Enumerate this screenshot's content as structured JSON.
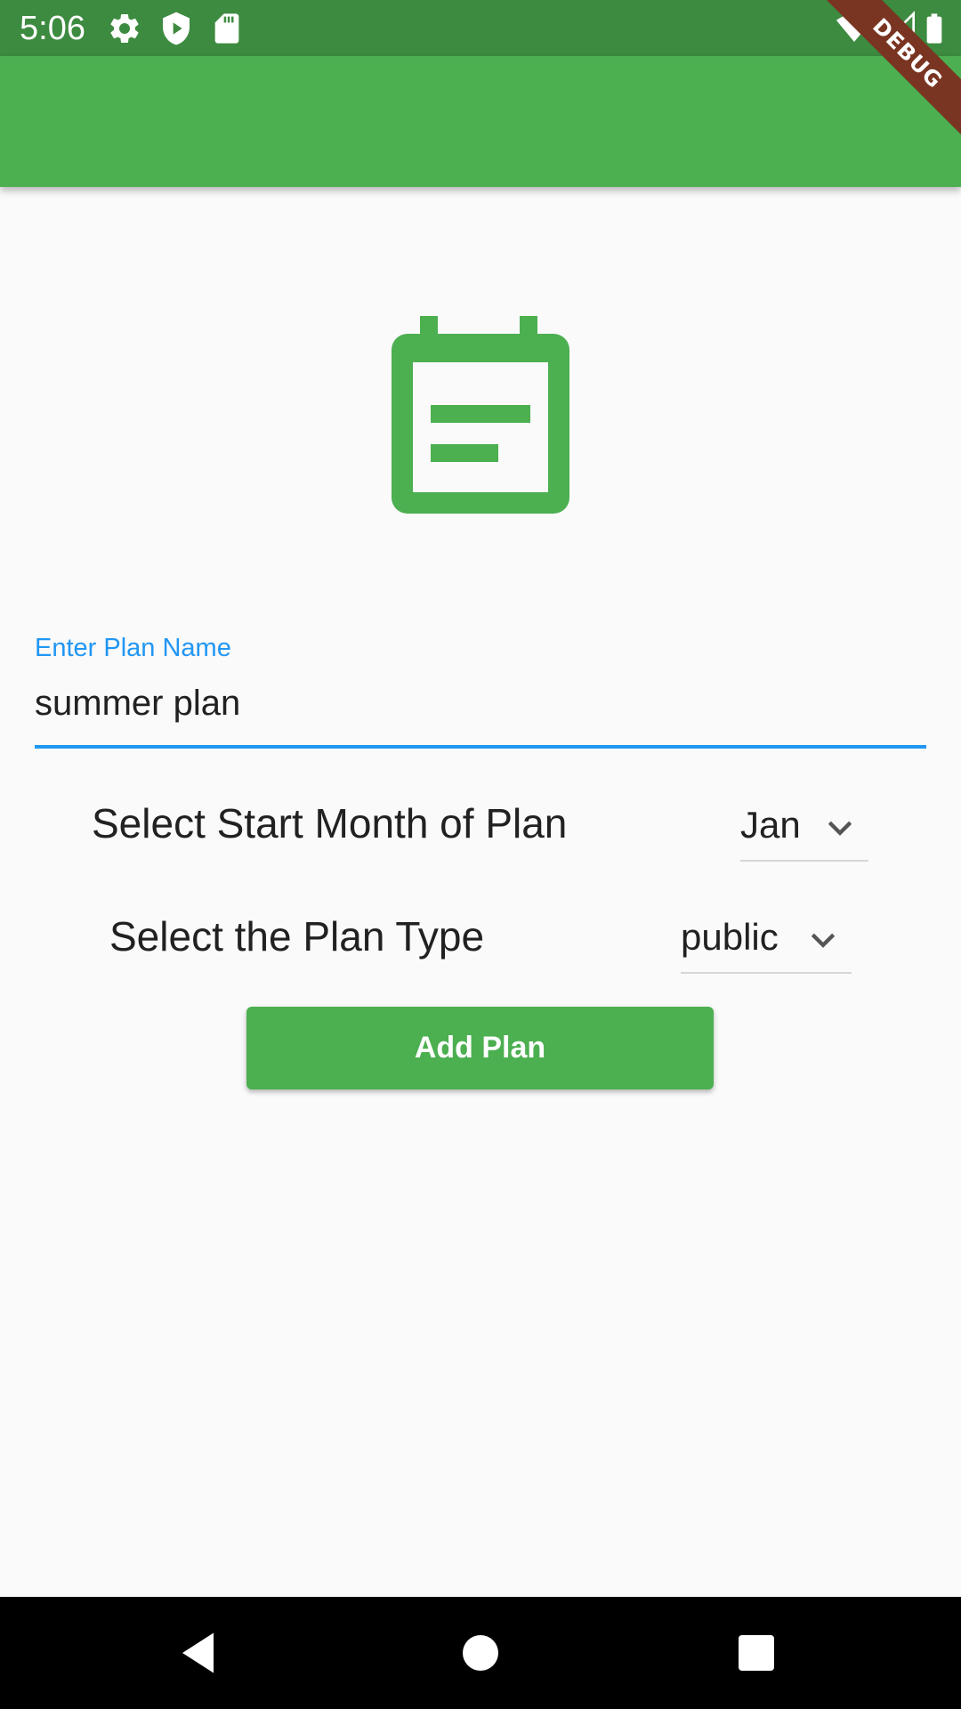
{
  "status_bar": {
    "time": "5:06",
    "left_icons": [
      "gear-icon",
      "shield-play-icon",
      "sd-card-icon"
    ],
    "right_icons": [
      "wifi-icon",
      "cell-signal-icon",
      "battery-icon"
    ],
    "background": "#3d8b40"
  },
  "debug_banner": {
    "text": "DEBUG",
    "color": "#7a3522"
  },
  "app_bar": {
    "background": "#4caf50"
  },
  "hero": {
    "icon": "calendar-event-icon",
    "color": "#4caf50"
  },
  "plan_name_field": {
    "label": "Enter Plan Name",
    "value": "summer plan",
    "accent": "#2196f3"
  },
  "start_month": {
    "label": "Select Start Month of Plan",
    "selected": "Jan"
  },
  "plan_type": {
    "label": "Select the Plan Type",
    "selected": "public"
  },
  "add_button": {
    "label": "Add Plan",
    "color": "#4caf50"
  },
  "nav_bar": {
    "icons": [
      "back-icon",
      "home-icon",
      "recents-icon"
    ]
  }
}
